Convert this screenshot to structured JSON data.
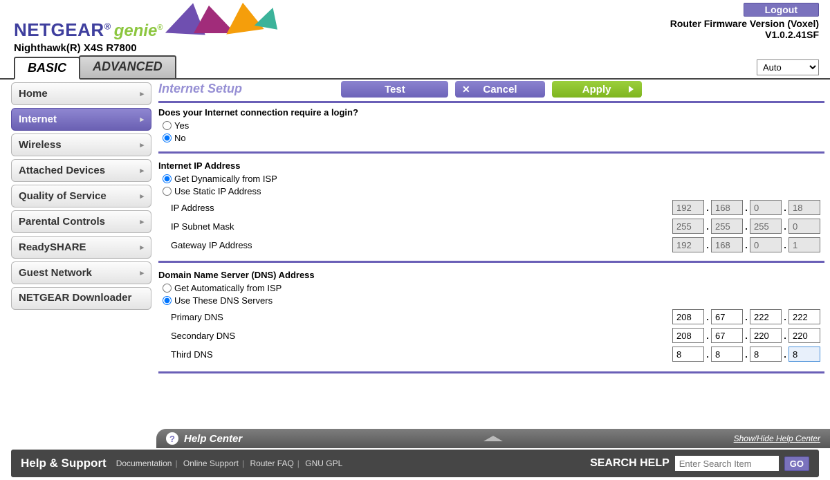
{
  "header": {
    "brand": "NETGEAR",
    "genie": "genie",
    "model": "Nighthawk(R) X4S R7800",
    "logout": "Logout",
    "fw_line1": "Router Firmware Version (Voxel)",
    "fw_line2": "V1.0.2.41SF"
  },
  "tabs": {
    "basic": "BASIC",
    "advanced": "ADVANCED",
    "lang": "Auto"
  },
  "sidebar": {
    "items": [
      {
        "label": "Home"
      },
      {
        "label": "Internet"
      },
      {
        "label": "Wireless"
      },
      {
        "label": "Attached Devices"
      },
      {
        "label": "Quality of Service"
      },
      {
        "label": "Parental Controls"
      },
      {
        "label": "ReadySHARE"
      },
      {
        "label": "Guest Network"
      },
      {
        "label": "NETGEAR Downloader"
      }
    ]
  },
  "page": {
    "title": "Internet Setup",
    "buttons": {
      "test": "Test",
      "cancel": "Cancel",
      "apply": "Apply"
    },
    "q_login": "Does your Internet connection require a login?",
    "yes": "Yes",
    "no": "No",
    "ip_section": "Internet IP Address",
    "ip_dyn": "Get Dynamically from ISP",
    "ip_static": "Use Static IP Address",
    "ip_address_lbl": "IP Address",
    "ip_subnet_lbl": "IP Subnet Mask",
    "ip_gateway_lbl": "Gateway IP Address",
    "ip_address": [
      "192",
      "168",
      "0",
      "18"
    ],
    "ip_subnet": [
      "255",
      "255",
      "255",
      "0"
    ],
    "ip_gateway": [
      "192",
      "168",
      "0",
      "1"
    ],
    "dns_section": "Domain Name Server (DNS) Address",
    "dns_auto": "Get Automatically from ISP",
    "dns_use": "Use These DNS Servers",
    "dns_primary_lbl": "Primary DNS",
    "dns_secondary_lbl": "Secondary DNS",
    "dns_third_lbl": "Third DNS",
    "dns_primary": [
      "208",
      "67",
      "222",
      "222"
    ],
    "dns_secondary": [
      "208",
      "67",
      "220",
      "220"
    ],
    "dns_third": [
      "8",
      "8",
      "8",
      "8"
    ]
  },
  "help": {
    "title": "Help Center",
    "show_hide": "Show/Hide Help Center"
  },
  "footer": {
    "title": "Help & Support",
    "links": [
      "Documentation",
      "Online Support",
      "Router FAQ",
      "GNU GPL"
    ],
    "search_lbl": "SEARCH HELP",
    "placeholder": "Enter Search Item",
    "go": "GO"
  }
}
